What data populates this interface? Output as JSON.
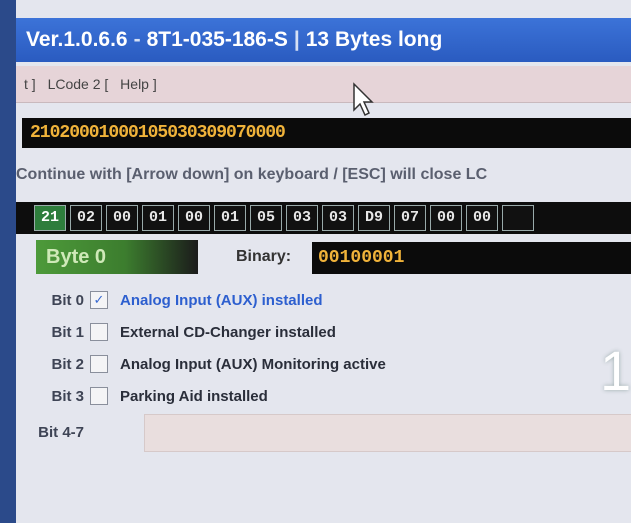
{
  "window": {
    "version": "Ver.1.0.6.6",
    "part_number": "8T1-035-186-S",
    "length": "13 Bytes long"
  },
  "menu": {
    "items": [
      "t ]",
      "LCode 2 [",
      "Help ]"
    ]
  },
  "hex_string": "21020001000105030309070000",
  "instruction": "Continue with [Arrow down] on keyboard / [ESC] will close LC",
  "bytes": [
    "21",
    "02",
    "00",
    "01",
    "00",
    "01",
    "05",
    "03",
    "03",
    "D9",
    "07",
    "00",
    "00"
  ],
  "byte_label": "Byte 0",
  "binary": {
    "label": "Binary:",
    "value": "00100001"
  },
  "bits": [
    {
      "label": "Bit 0",
      "checked": true,
      "text": "Analog Input (AUX) installed"
    },
    {
      "label": "Bit 1",
      "checked": false,
      "text": "External CD-Changer installed"
    },
    {
      "label": "Bit 2",
      "checked": false,
      "text": "Analog Input (AUX) Monitoring active"
    },
    {
      "label": "Bit 3",
      "checked": false,
      "text": "Parking Aid installed"
    }
  ],
  "bit47_label": "Bit 4-7",
  "big_digit": "1"
}
